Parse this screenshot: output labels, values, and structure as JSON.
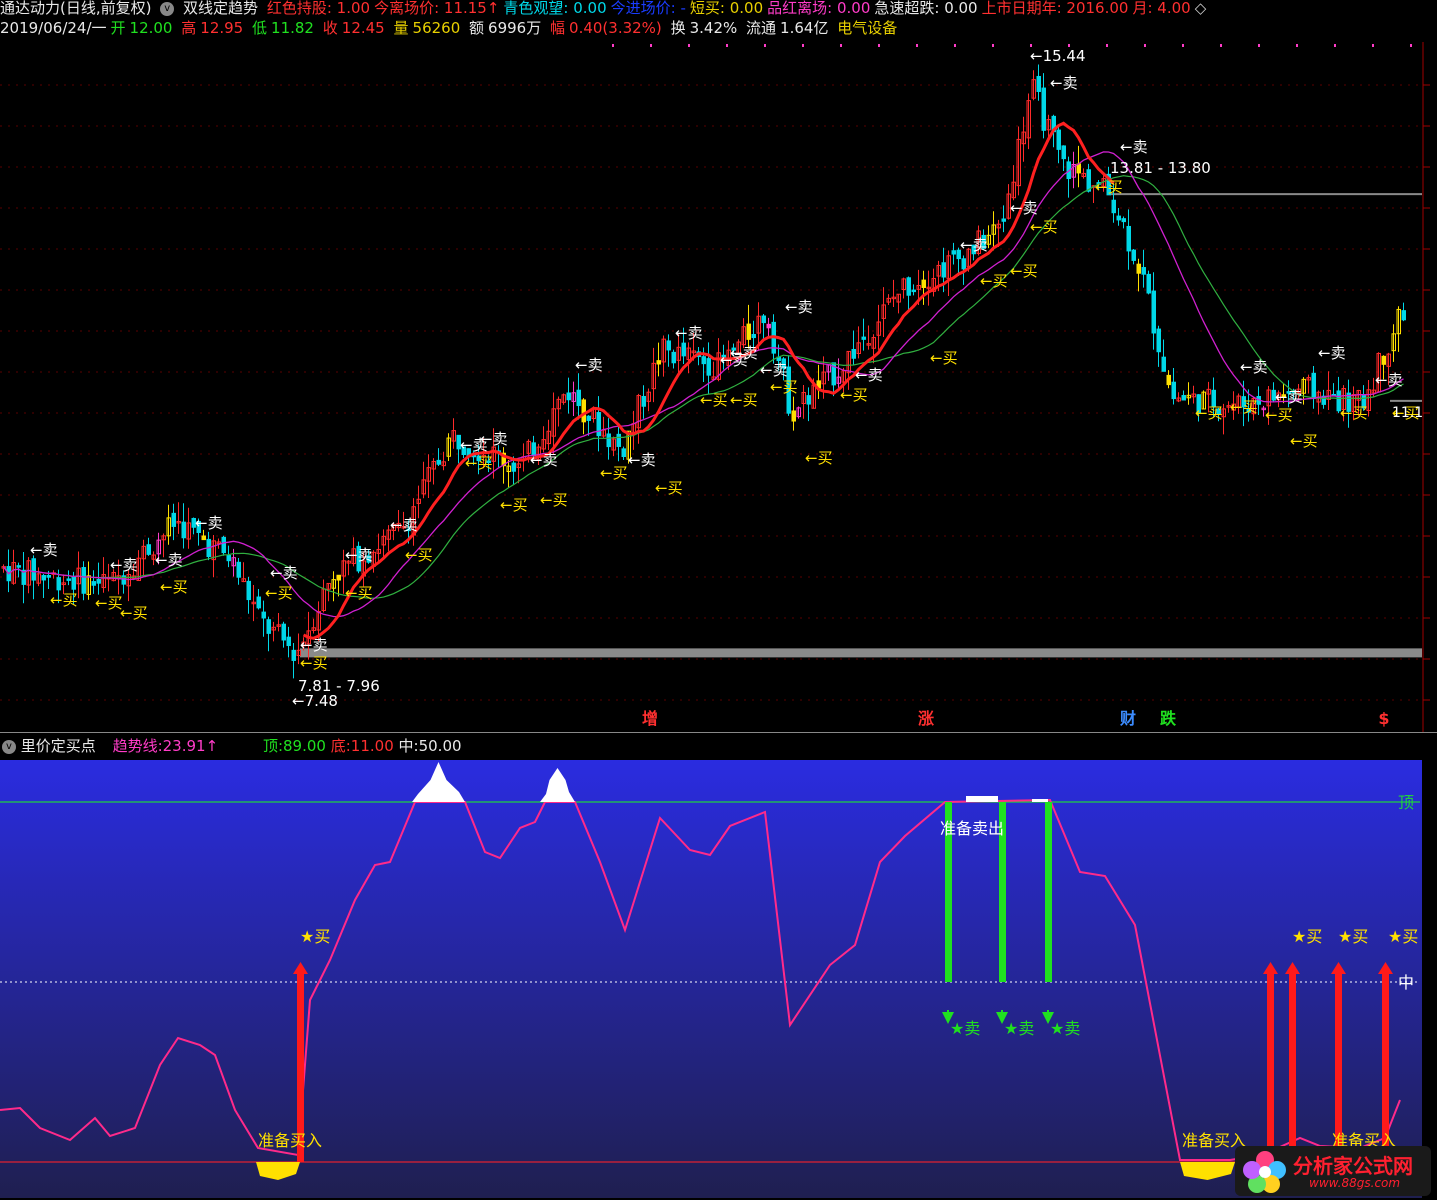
{
  "header": {
    "row1": {
      "title": "通达动力(日线,前复权)",
      "indicator_name": "双线定趋势",
      "items": [
        {
          "label": "红色持股:",
          "value": "1.00",
          "color": "#ff3030"
        },
        {
          "label": "今离场价:",
          "value": "11.15↑",
          "color": "#ff3030"
        },
        {
          "label": "青色观望:",
          "value": "0.00",
          "color": "#00d8e8"
        },
        {
          "label": "今进场价:",
          "value": "-",
          "color": "#1a3cff"
        },
        {
          "label": "短买:",
          "value": "0.00",
          "color": "#e8d000"
        },
        {
          "label": "品红离场:",
          "value": "0.00",
          "color": "#ff3cc8"
        },
        {
          "label": "急速超跌:",
          "value": "0.00",
          "color": "#e8e8e8"
        },
        {
          "label": "上市日期年:",
          "value": "2016.00",
          "color": "#ff3030"
        },
        {
          "label": "月:",
          "value": "4.00",
          "color": "#ff3030"
        }
      ]
    },
    "row2": {
      "date": "2019/06/24/一",
      "open_label": "开",
      "open": "12.00",
      "high_label": "高",
      "high": "12.95",
      "low_label": "低",
      "low": "11.82",
      "close_label": "收",
      "close": "12.45",
      "vol_label": "量",
      "vol": "56260",
      "amount_label": "额",
      "amount": "6996万",
      "range_label": "幅",
      "range": "0.40(3.32%)",
      "turnover_label": "换",
      "turnover": "3.42%",
      "float_label": "流通",
      "float": "1.64亿",
      "sector": "电气设备"
    }
  },
  "main_chart": {
    "peak_label": "15.44",
    "low_label": "7.48",
    "range_top_label": "13.81 - 13.80",
    "range_bottom_label": "7.81 - 7.96",
    "right_edge_label": "11.1",
    "sell_label": "卖",
    "buy_label": "买",
    "markers": [
      {
        "text": "增",
        "color": "#ff3030"
      },
      {
        "text": "涨",
        "color": "#ff3030"
      },
      {
        "text": "财",
        "color": "#3c8cff"
      },
      {
        "text": "跌",
        "color": "#20e020"
      },
      {
        "text": "$",
        "color": "#ff3030"
      }
    ]
  },
  "indicator": {
    "name": "里价定买点",
    "trend_label": "趋势线:",
    "trend_value": "23.91↑",
    "top_label": "顶:",
    "top_value": "89.00",
    "bottom_label": "底:",
    "bottom_value": "11.00",
    "mid_label": "中:",
    "mid_value": "50.00",
    "axis_top": "顶",
    "axis_mid": "中",
    "prepare_sell": "准备卖出",
    "prepare_buy": "准备买入",
    "buy_star": "★买",
    "sell_star": "★卖"
  },
  "watermark": {
    "title": "分析家公式网",
    "url": "www.88gs.com"
  },
  "colors": {
    "up": "#ff2a2a",
    "down": "#00d8e8",
    "ma_red": "#ff2020",
    "ma_mag": "#d020d0",
    "ma_green": "#30b040",
    "panel_top": "#2a2ce0",
    "panel_bottom": "#1f1f50"
  }
}
